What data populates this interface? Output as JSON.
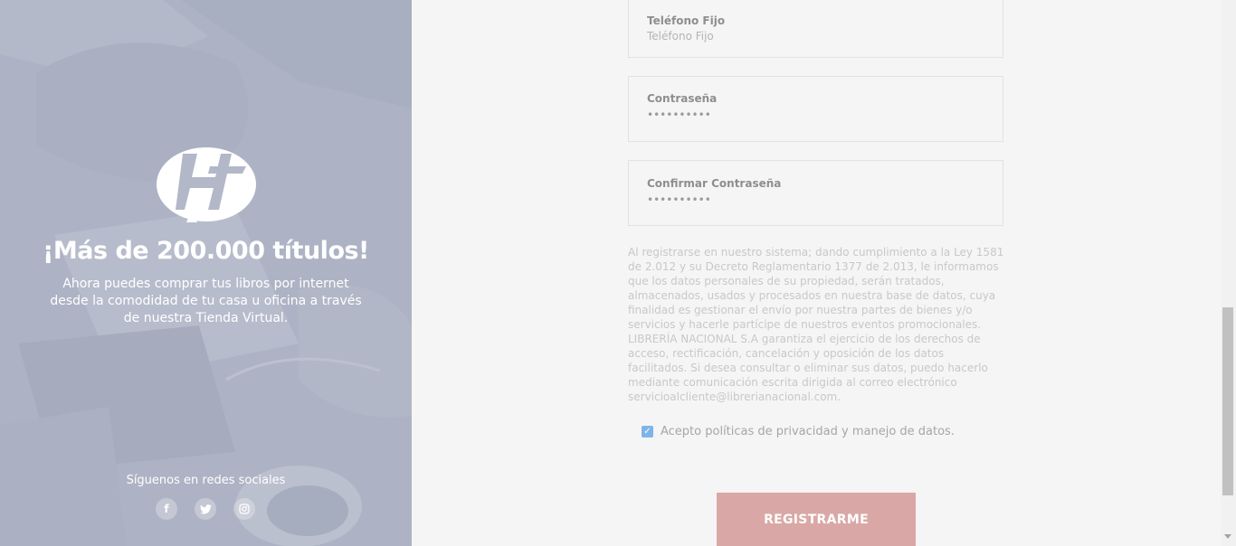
{
  "hero": {
    "headline": "¡Más de 200.000 títulos!",
    "subtext": "Ahora puedes comprar tus libros por internet desde la comodidad de tu casa u oficina a través de nuestra Tienda Virtual.",
    "social_label": "Síguenos en redes sociales",
    "social": [
      {
        "icon": "facebook-icon",
        "glyph": "f"
      },
      {
        "icon": "twitter-icon",
        "glyph": "🐦"
      },
      {
        "icon": "instagram-icon",
        "glyph": "◎"
      }
    ]
  },
  "form": {
    "phone": {
      "label": "Teléfono Fijo",
      "placeholder": "Teléfono Fijo"
    },
    "password": {
      "label": "Contraseña",
      "value": "••••••••••"
    },
    "confirm": {
      "label": "Confirmar Contraseña",
      "value": "••••••••••"
    },
    "legal_text": "Al registrarse en nuestro sistema; dando cumplimiento a la Ley 1581 de 2.012 y su Decreto Reglamentario 1377 de 2.013, le informamos que los datos personales de su propiedad, serán tratados, almacenados, usados y procesados en nuestra base de datos, cuya finalidad es gestionar el envío por nuestra partes de bienes y/o servicios y hacerle partícipe de nuestros eventos promocionales. LIBRERÍA NACIONAL S.A garantiza el ejercicio de los derechos de acceso, rectificación, cancelación y oposición de los datos facilitados. Si desea consultar o eliminar sus datos, puedo hacerlo mediante comunicación escrita dirigida al correo electrónico servicioalcliente@librerianacional.com.",
    "accept_label": "Acepto políticas de privacidad y manejo de datos.",
    "accept_checked": true,
    "submit_label": "REGISTRARME"
  },
  "colors": {
    "button": "#d9a8a6",
    "checkbox": "#7fb4e8",
    "panel": "#aeb4c4"
  }
}
